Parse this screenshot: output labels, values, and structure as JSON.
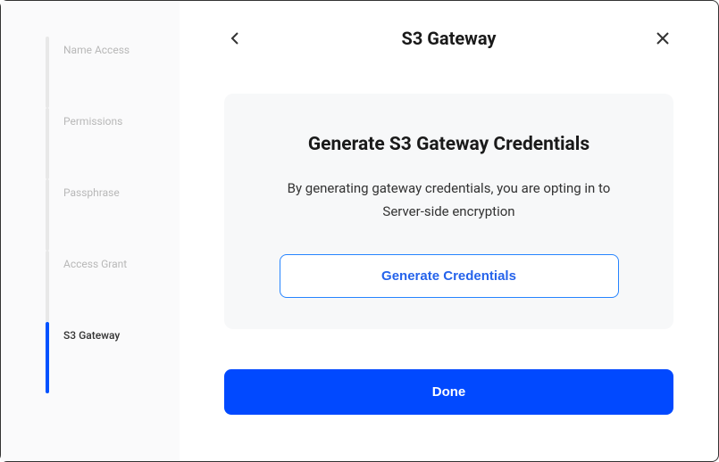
{
  "header": {
    "title": "S3 Gateway"
  },
  "sidebar": {
    "steps": [
      {
        "label": "Name Access",
        "active": false
      },
      {
        "label": "Permissions",
        "active": false
      },
      {
        "label": "Passphrase",
        "active": false
      },
      {
        "label": "Access Grant",
        "active": false
      },
      {
        "label": "S3 Gateway",
        "active": true
      }
    ]
  },
  "card": {
    "title": "Generate S3 Gateway Credentials",
    "description": "By generating gateway credentials, you are opting in to Server-side encryption",
    "generate_label": "Generate Credentials"
  },
  "footer": {
    "done_label": "Done"
  }
}
